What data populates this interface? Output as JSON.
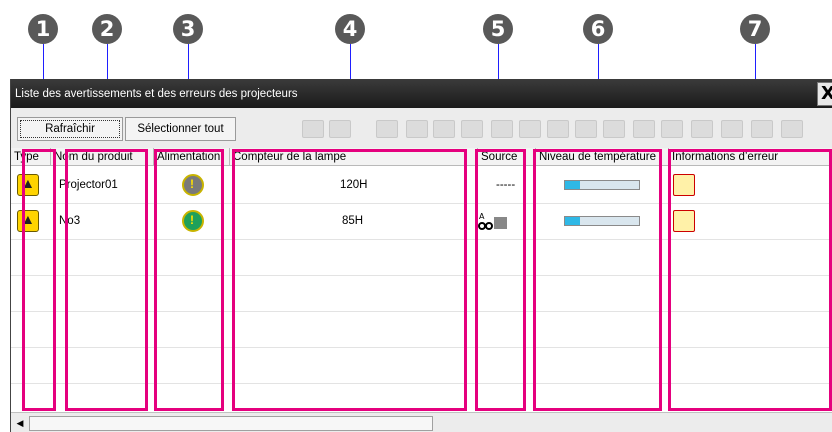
{
  "callouts": [
    "1",
    "2",
    "3",
    "4",
    "5",
    "6",
    "7"
  ],
  "window": {
    "title": "Liste des avertissements et des erreurs des projecteurs",
    "close_label": "X"
  },
  "toolbar": {
    "refresh_label": "Rafraîchir",
    "select_all_label": "Sélectionner tout",
    "icons": [
      "power-standby-icon",
      "power-on-icon",
      "input-computer1-icon",
      "input-computer2-icon",
      "input-video-icon",
      "input-svideo-icon",
      "input-component-icon",
      "input-hdmi-icon",
      "input-dvi-icon",
      "input-usb-icon",
      "input-serial-icon",
      "input-mp-icon",
      "network-icon",
      "usb-display-icon",
      "usb-device-icon",
      "wireless-icon"
    ]
  },
  "columns": [
    "Type",
    "Nom du produit",
    "Alimentation",
    "Compteur de la lampe",
    "Source",
    "Niveau de température",
    "Informations d’erreur"
  ],
  "rows": [
    {
      "type_icon": "warning-error-icon",
      "name": "Projector01",
      "power_icon": "power-warning-gray-icon",
      "lamp": "120H",
      "source": "-----",
      "temperature_fraction": 0.2,
      "error_icon": "fan-error-icon"
    },
    {
      "type_icon": "warning-icon",
      "name": "No3",
      "power_icon": "power-warning-green-icon",
      "lamp": "85H",
      "source": "video-input-icon",
      "temperature_fraction": 0.2,
      "error_icon": "lamp-error-icon"
    }
  ],
  "colors": {
    "callout": "#595959",
    "leader_line": "#1f1fff",
    "highlight": "#e5007e",
    "titlebar": "#1a1a1a"
  }
}
